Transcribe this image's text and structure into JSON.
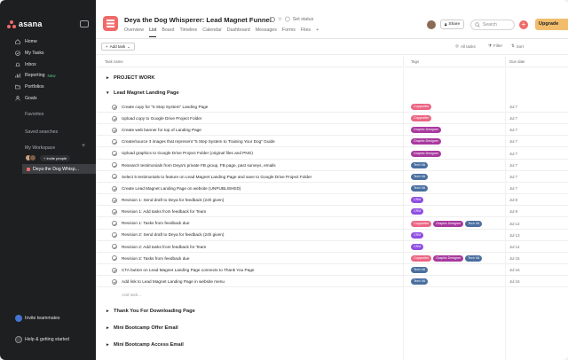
{
  "sidebar": {
    "logo": "asana",
    "nav": [
      {
        "label": "Home",
        "icon": "home-icon"
      },
      {
        "label": "My Tasks",
        "icon": "check-circle-icon"
      },
      {
        "label": "Inbox",
        "icon": "bell-icon"
      },
      {
        "label": "Reporting",
        "icon": "chart-icon",
        "badge": "New"
      },
      {
        "label": "Portfolios",
        "icon": "folder-icon"
      },
      {
        "label": "Goals",
        "icon": "person-icon"
      }
    ],
    "favorites": "Favorites",
    "saved_searches": "Saved searches",
    "workspace": "My Workspace",
    "invite_people": "+ Invite people",
    "project": "Deya the Dog Whisp...",
    "invite_teammates": "Invite teammates",
    "help": "Help & getting started"
  },
  "header": {
    "title": "Deya the Dog Whisperer: Lead Magnet Funnel",
    "set_status": "Set status",
    "tabs": [
      "Overview",
      "List",
      "Board",
      "Timeline",
      "Calendar",
      "Dashboard",
      "Messages",
      "Forms",
      "Files"
    ],
    "active_tab": "List",
    "share": "Share",
    "search_placeholder": "Search",
    "upgrade": "Upgrade"
  },
  "toolbar": {
    "add_task": "Add task",
    "all_tasks": "All tasks",
    "filter": "Filter",
    "sort": "Sort"
  },
  "columns": {
    "name": "Task name",
    "tags": "Tags",
    "due": "Due date"
  },
  "colors": {
    "copywriter": "#ec6583",
    "graphic_designer": "#a8399f",
    "tech_va": "#4a6fa0",
    "crm": "#8e4ee3",
    "brand": "#f06a6a",
    "sidebar_bg": "#1e1f21"
  },
  "sections": [
    {
      "name": "PROJECT WORK",
      "expanded": false
    },
    {
      "name": "Lead Magnet Landing Page",
      "expanded": true
    }
  ],
  "tasks": [
    {
      "name": "Create copy for \"5 Step System\" Landing Page",
      "tags": [
        {
          "label": "Copywriter",
          "color": "#ec6583"
        }
      ],
      "due": "Jul 7"
    },
    {
      "name": "Upload copy to Google Drive Project Folder",
      "tags": [
        {
          "label": "Copywriter",
          "color": "#ec6583"
        }
      ],
      "due": "Jul 7"
    },
    {
      "name": "Create web banner for top of Landing Page",
      "tags": [
        {
          "label": "Graphic Designer",
          "color": "#a8399f"
        }
      ],
      "due": "Jul 7"
    },
    {
      "name": "Create/source 3 images that represent \"5 Step System to Training Your Dog\" Guide",
      "tags": [
        {
          "label": "Graphic Designer",
          "color": "#a8399f"
        }
      ],
      "due": "Jul 7"
    },
    {
      "name": "Upload graphics to Google Drive Project Folder (original files and PNG)",
      "tags": [
        {
          "label": "Graphic Designer",
          "color": "#a8399f"
        }
      ],
      "due": "Jul 7"
    },
    {
      "name": "Research testimonials from Deya's private FB group, FB page, past surveys, emails",
      "tags": [
        {
          "label": "Tech VA",
          "color": "#4a6fa0"
        }
      ],
      "due": "Jul 7"
    },
    {
      "name": "Select 5 testimonials to feature on Lead Magnet Landing Page and save to Google Drive Project Folder",
      "tags": [
        {
          "label": "Tech VA",
          "color": "#4a6fa0"
        }
      ],
      "due": "Jul 7"
    },
    {
      "name": "Create Lead Magnet Landing Page on website (UNPUBLISHED)",
      "tags": [
        {
          "label": "Tech VA",
          "color": "#4a6fa0"
        }
      ],
      "due": "Jul 7"
    },
    {
      "name": "Revision 1: Send draft to Deya for feedback (24h given)",
      "tags": [
        {
          "label": "CRM",
          "color": "#8e4ee3"
        }
      ],
      "due": "Jul 8"
    },
    {
      "name": "Revision 1: Add tasks from feedback for Team",
      "tags": [
        {
          "label": "CRM",
          "color": "#8e4ee3"
        }
      ],
      "due": "Jul 9"
    },
    {
      "name": "Revision 1: Tasks from feedback due",
      "tags": [
        {
          "label": "Copywriter",
          "color": "#ec6583"
        },
        {
          "label": "Graphic Designer",
          "color": "#a8399f"
        },
        {
          "label": "Tech VA",
          "color": "#4a6fa0"
        }
      ],
      "due": "Jul 12"
    },
    {
      "name": "Revision 2: Send draft to Deya for feedback (24h given)",
      "tags": [
        {
          "label": "CRM",
          "color": "#8e4ee3"
        }
      ],
      "due": "Jul 13"
    },
    {
      "name": "Revision 2: Add tasks from feedback for Team",
      "tags": [
        {
          "label": "CRM",
          "color": "#8e4ee3"
        }
      ],
      "due": "Jul 14"
    },
    {
      "name": "Revision 2: Tasks from feedback due",
      "tags": [
        {
          "label": "Copywriter",
          "color": "#ec6583"
        },
        {
          "label": "Graphic Designer",
          "color": "#a8399f"
        },
        {
          "label": "Tech VA",
          "color": "#4a6fa0"
        }
      ],
      "due": "Jul 15"
    },
    {
      "name": "CTA button on Lead Magnet Landing Page connects to Thank You Page",
      "tags": [
        {
          "label": "Tech VA",
          "color": "#4a6fa0"
        }
      ],
      "due": "Jul 16"
    },
    {
      "name": "Add link to Lead Magnet Landing Page in website menu",
      "tags": [
        {
          "label": "Tech VA",
          "color": "#4a6fa0"
        }
      ],
      "due": "Jul 16"
    }
  ],
  "add_task_link": "Add task...",
  "collapsed_sections": [
    "Thank You For Downloading Page",
    "Mini Bootcamp Offer Email",
    "Mini Bootcamp Access Email"
  ]
}
